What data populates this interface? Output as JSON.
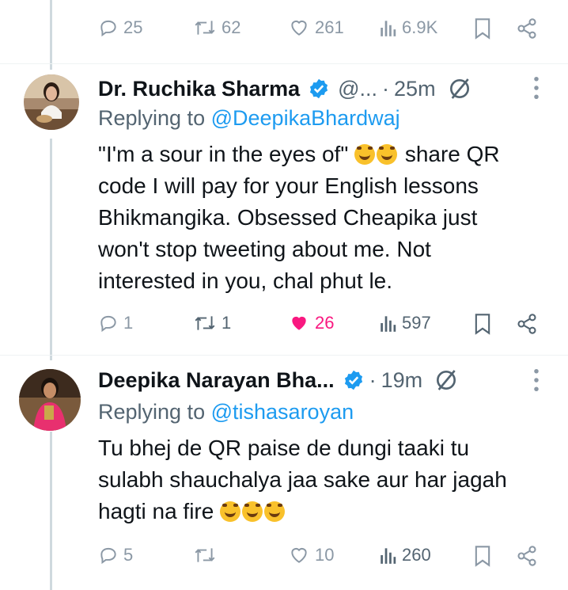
{
  "top_actions": {
    "replies": "25",
    "retweets": "62",
    "likes": "261",
    "views": "6.9K"
  },
  "tweets": [
    {
      "name": "Dr. Ruchika Sharma",
      "handle": "@...",
      "time": "25m",
      "reply_prefix": "Replying to",
      "reply_to": "@DeepikaBhardwaj",
      "body_lines": [
        "\"I'm a sour in the eyes of\"",
        "share QR",
        "code I will pay for your English lessons",
        "Bhikmangika. Obsessed Cheapika just",
        "won't stop tweeting about me. Not",
        "interested in you, chal phut le."
      ],
      "actions": {
        "replies": "1",
        "retweets": "1",
        "likes": "26",
        "views": "597"
      },
      "liked": true
    },
    {
      "name": "Deepika Narayan Bha...",
      "handle": "",
      "time": "19m",
      "reply_prefix": "Replying to",
      "reply_to": "@tishasaroyan",
      "body_lines": [
        "Tu bhej de QR paise de dungi taaki tu",
        "sulabh shauchalya jaa sake aur har jagah",
        "hagti na fire"
      ],
      "actions": {
        "replies": "5",
        "retweets": "",
        "likes": "10",
        "views": "260"
      },
      "liked": false
    }
  ],
  "colors": {
    "accent": "#1d9bf0",
    "like": "#f91880",
    "muted": "#536471",
    "icon": "#8b98a5"
  },
  "icons": [
    "reply-icon",
    "retweet-icon",
    "like-icon",
    "views-icon",
    "bookmark-icon",
    "share-icon",
    "verified-icon",
    "grok-icon",
    "more-icon",
    "laughing-emoji"
  ]
}
